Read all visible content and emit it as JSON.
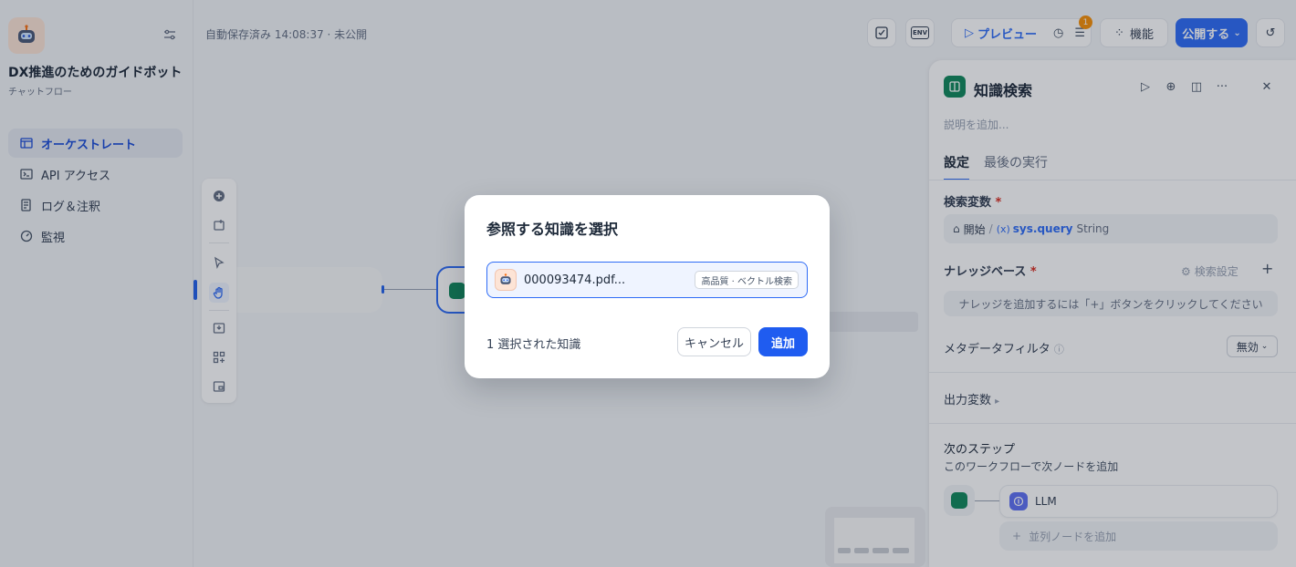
{
  "app": {
    "name": "DX推進のためのガイドボット",
    "type": "チャットフロー"
  },
  "nav": [
    {
      "label": "オーケストレート",
      "icon": "layout-icon",
      "active": true
    },
    {
      "label": "API アクセス",
      "icon": "terminal-icon",
      "active": false
    },
    {
      "label": "ログ＆注釈",
      "icon": "log-icon",
      "active": false
    },
    {
      "label": "監視",
      "icon": "gauge-icon",
      "active": false
    }
  ],
  "canvas": {
    "autosave": "自動保存済み 14:08:37 · 未公開"
  },
  "topbar": {
    "preview_label": "プレビュー",
    "features_label": "機能",
    "publish_label": "公開する",
    "badge_count": "1",
    "env_label": "ENV"
  },
  "panel": {
    "title": "知識検索",
    "description_placeholder": "説明を追加...",
    "tabs": [
      "設定",
      "最後の実行"
    ],
    "query_var_label": "検索変数",
    "query_var": {
      "source": "開始",
      "sep": "/",
      "name": "sys.query",
      "type": "String"
    },
    "kb_label": "ナレッジベース",
    "kb_settings": "検索設定",
    "kb_empty": "ナレッジを追加するには「+」ボタンをクリックしてください",
    "metadata_label": "メタデータフィルタ",
    "metadata_value": "無効",
    "output_label": "出力変数",
    "next_step_label": "次のステップ",
    "next_step_desc": "このワークフローで次ノードを追加",
    "next_node": "LLM",
    "add_parallel": "並列ノードを追加"
  },
  "modal": {
    "title": "参照する知識を選択",
    "item": {
      "name": "000093474.pdf...",
      "tag": "高品質 · ベクトル検索"
    },
    "count_text": "1 選択された知識",
    "cancel_label": "キャンセル",
    "add_label": "追加"
  },
  "colors": {
    "accent": "#2f6cf6",
    "node_green": "#12885c",
    "badge_orange": "#f79009",
    "required_red": "#d92d20"
  }
}
